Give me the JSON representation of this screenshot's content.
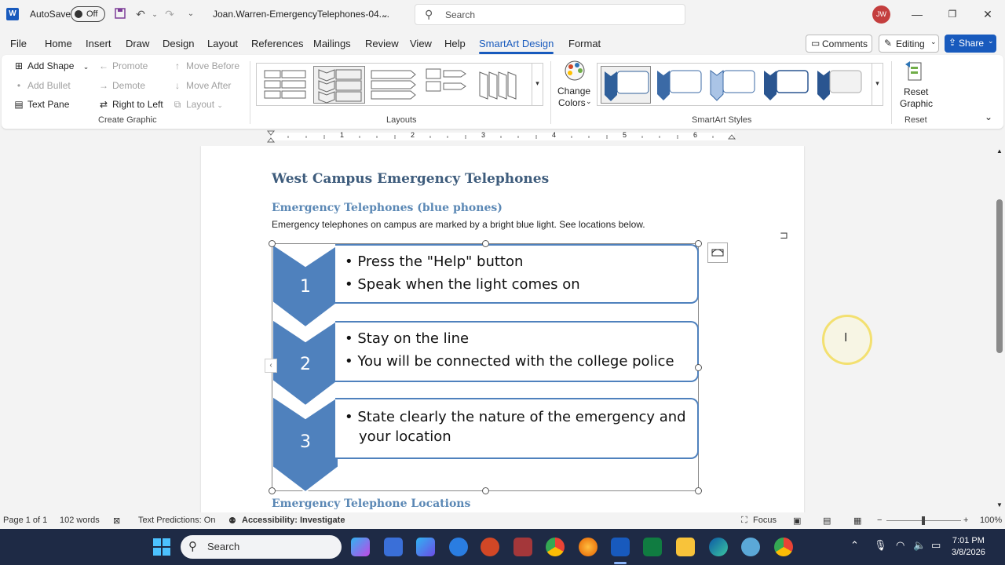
{
  "titlebar": {
    "app_logo": "W",
    "autosave_label": "AutoSave",
    "autosave_state": "Off",
    "doc_title": "Joan.Warren-EmergencyTelephones-04....",
    "search_placeholder": "Search",
    "user_initials": "JW"
  },
  "menu": {
    "items": [
      "File",
      "Home",
      "Insert",
      "Draw",
      "Design",
      "Layout",
      "References",
      "Mailings",
      "Review",
      "View",
      "Help",
      "SmartArt Design",
      "Format"
    ],
    "active": "SmartArt Design",
    "comments": "Comments",
    "editing": "Editing",
    "share": "Share"
  },
  "ribbon": {
    "create_graphic": {
      "add_shape": "Add Shape",
      "add_bullet": "Add Bullet",
      "text_pane": "Text Pane",
      "promote": "Promote",
      "demote": "Demote",
      "right_to_left": "Right to Left",
      "move_before": "Move Before",
      "move_after": "Move After",
      "layout": "Layout",
      "label": "Create Graphic"
    },
    "layouts_label": "Layouts",
    "change_colors_1": "Change",
    "change_colors_2": "Colors",
    "styles_label": "SmartArt Styles",
    "reset_graphic_1": "Reset",
    "reset_graphic_2": "Graphic",
    "reset_label": "Reset"
  },
  "ruler": {
    "numbers": [
      "1",
      "2",
      "3",
      "4",
      "5",
      "6"
    ]
  },
  "document": {
    "heading": "West Campus Emergency Telephones",
    "subheading": "Emergency Telephones (blue phones)",
    "paragraph": "Emergency telephones on campus are marked by a bright blue light. See locations below.",
    "next_heading": "Emergency Telephone Locations",
    "smartart": [
      {
        "number": "1",
        "bullets": [
          "Press the \"Help\" button",
          "Speak when the light comes on"
        ]
      },
      {
        "number": "2",
        "bullets": [
          "Stay on the line",
          "You will be connected with the college police"
        ]
      },
      {
        "number": "3",
        "bullets": [
          "State clearly the nature of the emergency and",
          "your location"
        ]
      }
    ],
    "accent_color": "#4f81bd"
  },
  "statusbar": {
    "page": "Page 1 of 1",
    "words": "102 words",
    "text_predictions": "Text Predictions: On",
    "accessibility": "Accessibility: Investigate",
    "focus": "Focus",
    "zoom": "100%"
  },
  "taskbar": {
    "search": "Search",
    "time": "7:01 PM",
    "date": "3/8/2026"
  }
}
